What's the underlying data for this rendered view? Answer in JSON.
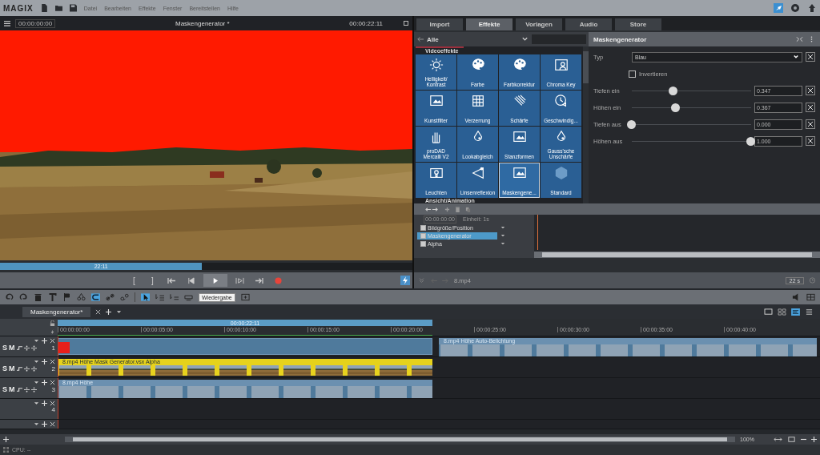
{
  "app": {
    "logo": "MAGIX",
    "menu": [
      "Datei",
      "Bearbeiten",
      "Effekte",
      "Fenster",
      "Bereitstellen",
      "Hilfe"
    ]
  },
  "preview": {
    "timecode": "00:00:00:00",
    "title": "Maskengenerator *",
    "duration": "00:00:22:11",
    "scrub_label": "22:11",
    "level": 0.49,
    "transport": [
      {
        "kind": "mark-in",
        "label": "[",
        "selected": false
      },
      {
        "kind": "mark-out",
        "label": "]",
        "selected": false
      },
      {
        "kind": "to-start",
        "selected": false
      },
      {
        "kind": "prev",
        "selected": false
      },
      {
        "kind": "play",
        "selected": true
      },
      {
        "kind": "next",
        "selected": false
      },
      {
        "kind": "to-end",
        "selected": false
      },
      {
        "kind": "record",
        "selected": false
      }
    ]
  },
  "panel": {
    "tabs": [
      {
        "label": "Import",
        "selected": false
      },
      {
        "label": "Effekte",
        "selected": true
      },
      {
        "label": "Vorlagen",
        "selected": false
      },
      {
        "label": "Audio",
        "selected": false
      },
      {
        "label": "Store",
        "selected": false
      }
    ],
    "browser": {
      "filter": "Alle",
      "section": "Videoeffekte",
      "next_section": "Ansicht/Animation",
      "effects": [
        {
          "label": "Helligkeit/ Kontrast",
          "selected": false
        },
        {
          "label": "Farbe",
          "selected": false
        },
        {
          "label": "Farbkorrektur",
          "selected": false
        },
        {
          "label": "Chroma Key",
          "selected": false
        },
        {
          "label": "Kunstfilter",
          "selected": false
        },
        {
          "label": "Verzerrung",
          "selected": false
        },
        {
          "label": "Schärfe",
          "selected": false
        },
        {
          "label": "Geschwindig...",
          "selected": false
        },
        {
          "label": "proDAD Mercalli V2",
          "selected": false
        },
        {
          "label": "Lookabgleich",
          "selected": false
        },
        {
          "label": "Stanzformen",
          "selected": false
        },
        {
          "label": "Gauss'sche Unschärfe",
          "selected": false
        },
        {
          "label": "Leuchten",
          "selected": false
        },
        {
          "label": "Linsenreflexion",
          "selected": false
        },
        {
          "label": "Maskengene...",
          "selected": true
        },
        {
          "label": "Standard",
          "selected": false
        }
      ]
    },
    "effect": {
      "title": "Maskengenerator",
      "type_label": "Typ",
      "type_value": "Blau",
      "invert": {
        "label": "Invertieren",
        "checked": false
      },
      "sliders": [
        {
          "label": "Tiefen ein",
          "level": 0.347,
          "value": "0.347"
        },
        {
          "label": "Höhen ein",
          "level": 0.367,
          "value": "0.367"
        },
        {
          "label": "Tiefen aus",
          "level": 0,
          "value": "0.000"
        },
        {
          "label": "Höhen aus",
          "level": 1,
          "value": "1.000"
        }
      ]
    },
    "keyframes": {
      "timecode": "00:00:00:00",
      "unit": "Einheit: 1s",
      "rows": [
        {
          "label": "Bildgröße/Position",
          "checked": true,
          "selected": false
        },
        {
          "label": "Maskengenerator",
          "checked": true,
          "selected": true
        },
        {
          "label": "Alpha",
          "checked": true,
          "selected": false
        }
      ]
    },
    "footer": {
      "file": "8.mp4",
      "duration": "22 s"
    }
  },
  "timeline": {
    "tooltip": "Wiedergabe",
    "tab": "Maskengenerator*",
    "range_label": "00:00:22:11",
    "ruler": [
      "00:00:00:00",
      "00:00:05:00",
      "00:00:10:00",
      "00:00:15:00",
      "00:00:20:00",
      "00:00:25:00",
      "00:00:30:00",
      "00:00:35:00",
      "00:00:40:00"
    ],
    "tracks": [
      {
        "kind": "track",
        "solo": "S",
        "mute": "M",
        "number": "1",
        "clips": [
          {
            "kind": "title"
          },
          {
            "kind": "video",
            "label": "8.mp4  Höhe  Auto-Belichtung"
          }
        ]
      },
      {
        "kind": "track",
        "solo": "S",
        "mute": "M",
        "number": "2",
        "clips": [
          {
            "kind": "mask",
            "label": "8.mp4  Höhe  Mask Generator.vsx  Alpha"
          }
        ]
      },
      {
        "kind": "track",
        "solo": "S",
        "mute": "M",
        "number": "3",
        "clips": [
          {
            "kind": "video",
            "label": "8.mp4  Höhe"
          }
        ]
      },
      {
        "kind": "track",
        "number": "4"
      },
      {
        "kind": "track"
      }
    ],
    "zoom": "100%"
  },
  "status": "CPU: --"
}
